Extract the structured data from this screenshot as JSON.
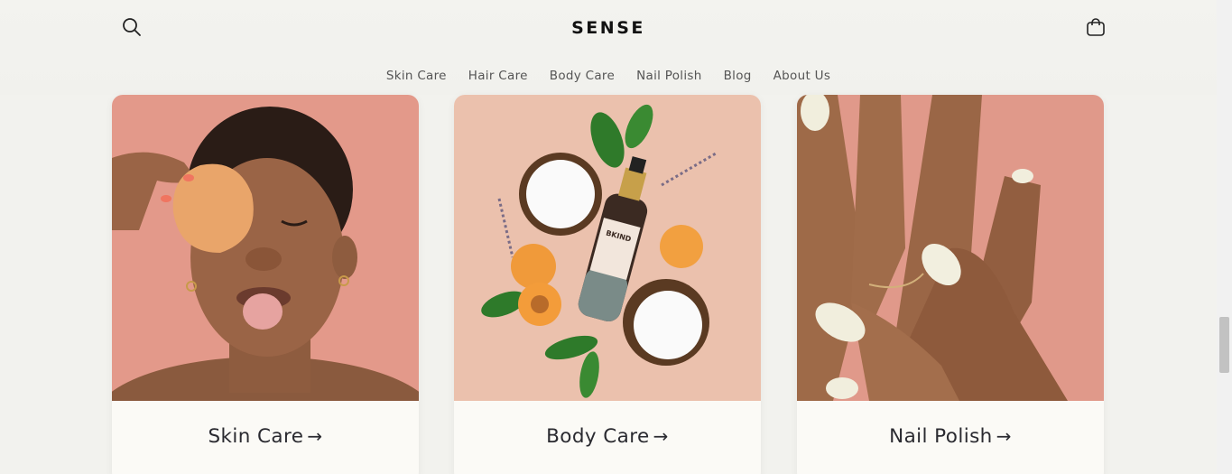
{
  "header": {
    "logo": "SENSE",
    "search_icon": "search-icon",
    "cart_icon": "cart-icon"
  },
  "nav": {
    "items": [
      {
        "label": "Skin Care"
      },
      {
        "label": "Hair Care"
      },
      {
        "label": "Body Care"
      },
      {
        "label": "Nail Polish"
      },
      {
        "label": "Blog"
      },
      {
        "label": "About Us"
      }
    ]
  },
  "collections": [
    {
      "label": "Skin Care",
      "arrow": "→"
    },
    {
      "label": "Body Care",
      "arrow": "→"
    },
    {
      "label": "Nail Polish",
      "arrow": "→"
    }
  ],
  "product_bottle_label": "BKIND",
  "colors": {
    "background": "#f2f2ee",
    "card": "#fbfaf6",
    "peach": "#e39a8b",
    "text": "#121212"
  }
}
